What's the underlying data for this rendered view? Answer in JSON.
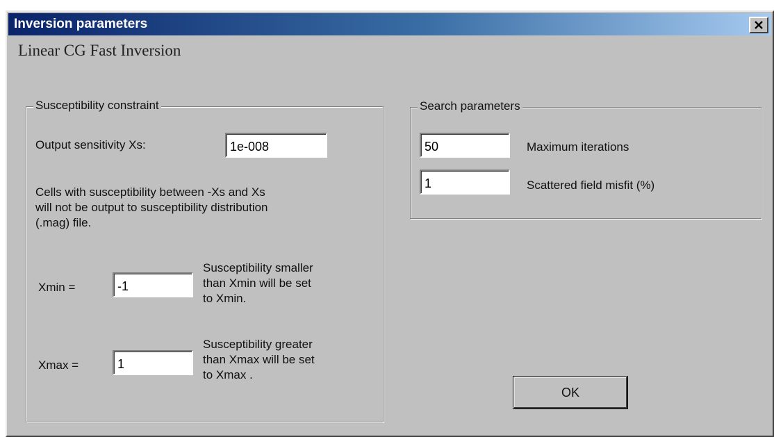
{
  "window": {
    "title": "Inversion parameters",
    "close_icon": "close-icon"
  },
  "heading": "Linear CG Fast Inversion",
  "susceptibility": {
    "group_title": "Susceptibility constraint",
    "output_label": "Output sensitivity Xs:",
    "output_value": "1e-008",
    "info_lines": [
      "Cells with susceptibility between -Xs and Xs",
      "will not be output to susceptibility distribution",
      "(.mag) file."
    ],
    "xmin_label": "Xmin =",
    "xmin_value": "-1",
    "xmin_desc_lines": [
      "Susceptibility smaller",
      "than Xmin will be set",
      "to Xmin."
    ],
    "xmax_label": "Xmax =",
    "xmax_value": "1",
    "xmax_desc_lines": [
      "Susceptibility greater",
      "than  Xmax will be set",
      "to Xmax ."
    ]
  },
  "search": {
    "group_title": "Search parameters",
    "max_iter_value": "50",
    "max_iter_label": "Maximum iterations",
    "misfit_value": "1",
    "misfit_label": "Scattered field misfit (%)"
  },
  "ok_label": "OK"
}
